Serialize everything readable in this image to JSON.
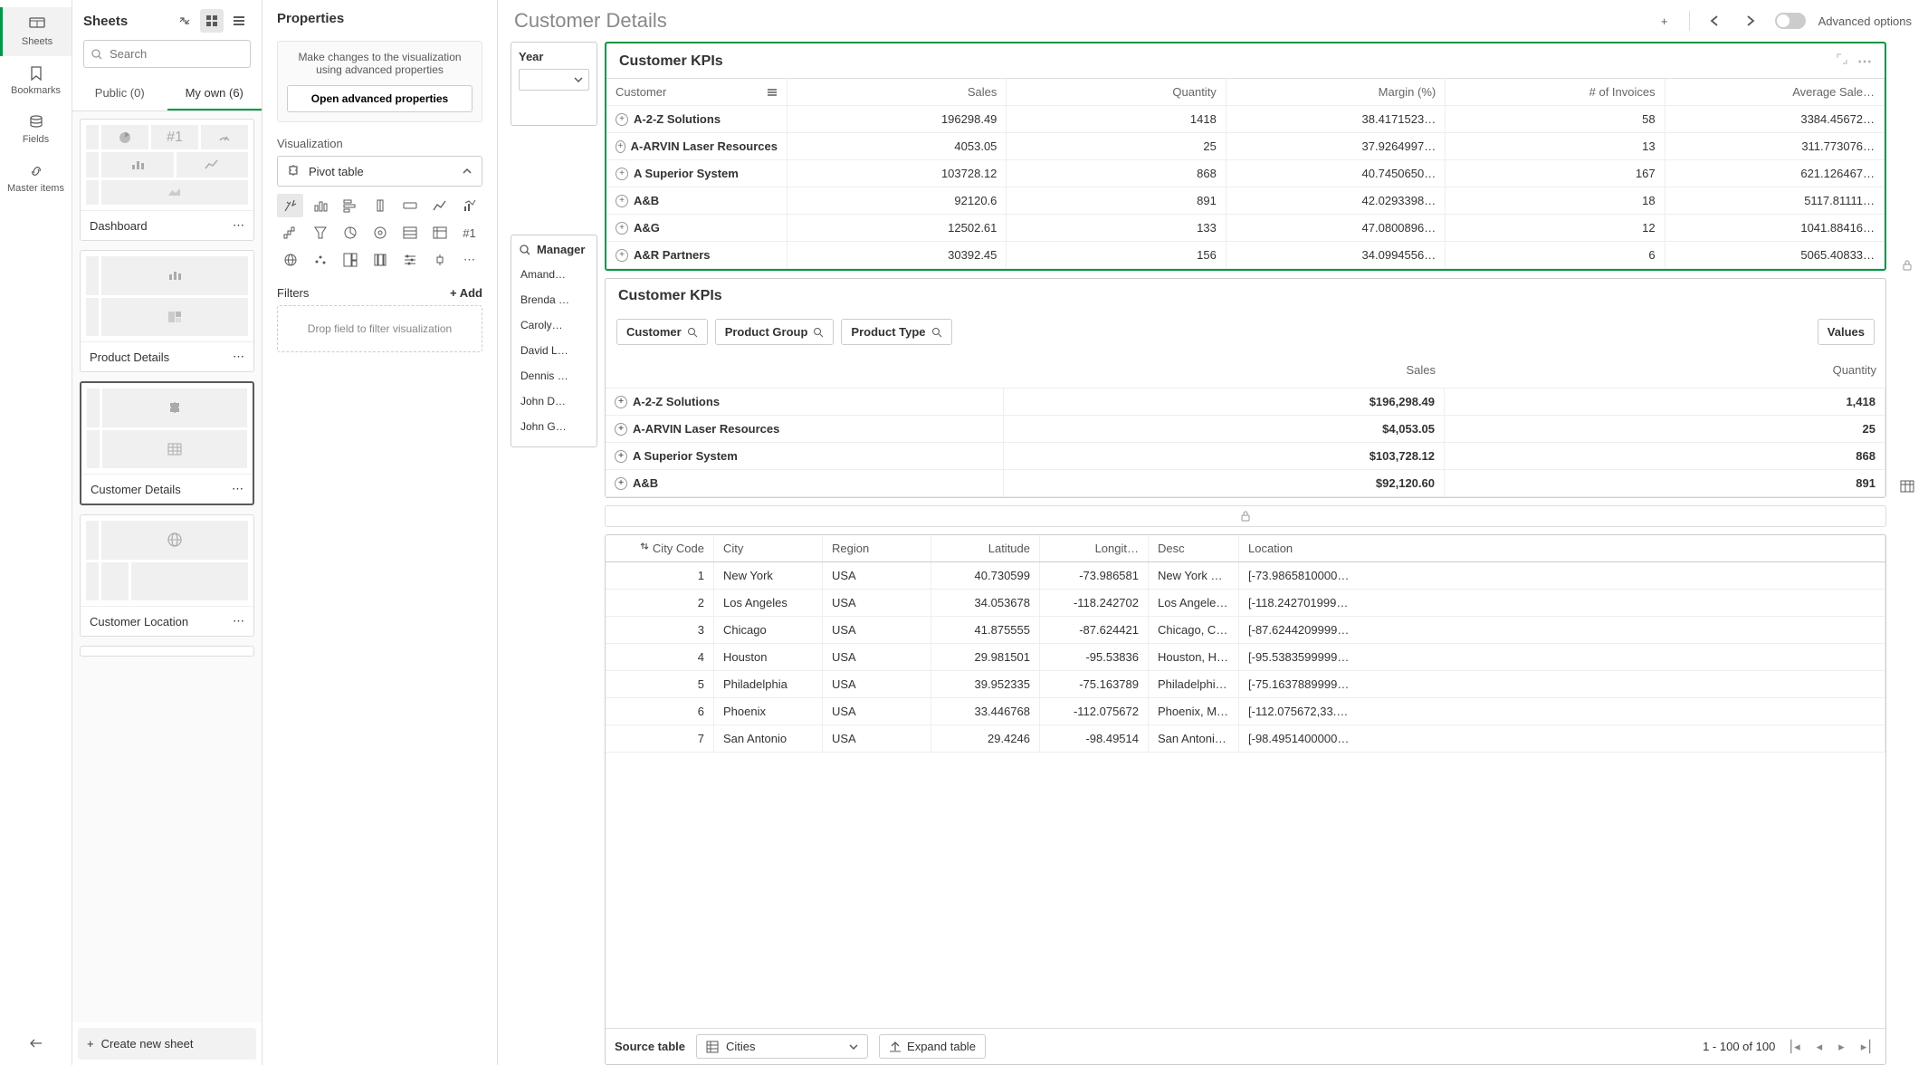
{
  "rail": {
    "sheets": "Sheets",
    "bookmarks": "Bookmarks",
    "fields": "Fields",
    "master": "Master items"
  },
  "sheetsPanel": {
    "title": "Sheets",
    "searchPlaceholder": "Search",
    "tabs": {
      "public": "Public (0)",
      "myown": "My own (6)"
    },
    "cards": [
      {
        "name": "Dashboard"
      },
      {
        "name": "Product Details"
      },
      {
        "name": "Customer Details"
      },
      {
        "name": "Customer Location"
      }
    ],
    "createNew": "Create new sheet"
  },
  "properties": {
    "title": "Properties",
    "hint": "Make changes to the visualization using advanced properties",
    "advBtn": "Open advanced properties",
    "vizSection": "Visualization",
    "vizName": "Pivot table",
    "filtersSection": "Filters",
    "addLabel": "Add",
    "filterDrop": "Drop field to filter visualization"
  },
  "main": {
    "title": "Customer Details",
    "advOptions": "Advanced options",
    "year": {
      "label": "Year"
    },
    "manager": {
      "label": "Manager",
      "items": [
        "Amand…",
        "Brenda …",
        "Caroly…",
        "David L…",
        "Dennis …",
        "John D…",
        "John G…"
      ]
    },
    "kpi1": {
      "title": "Customer KPIs",
      "columns": [
        "Customer",
        "Sales",
        "Quantity",
        "Margin (%)",
        "# of Invoices",
        "Average Sale…"
      ],
      "rows": [
        [
          "A-2-Z Solutions",
          "196298.49",
          "1418",
          "38.4171523…",
          "58",
          "3384.45672…"
        ],
        [
          "A-ARVIN Laser Resources",
          "4053.05",
          "25",
          "37.9264997…",
          "13",
          "311.773076…"
        ],
        [
          "A Superior System",
          "103728.12",
          "868",
          "40.7450650…",
          "167",
          "621.126467…"
        ],
        [
          "A&B",
          "92120.6",
          "891",
          "42.0293398…",
          "18",
          "5117.81111…"
        ],
        [
          "A&G",
          "12502.61",
          "133",
          "47.0800896…",
          "12",
          "1041.88416…"
        ],
        [
          "A&R Partners",
          "30392.45",
          "156",
          "34.0994556…",
          "6",
          "5065.40833…"
        ]
      ]
    },
    "kpi2": {
      "title": "Customer KPIs",
      "chips": [
        "Customer",
        "Product Group",
        "Product Type"
      ],
      "valuesChip": "Values",
      "headers": [
        "Sales",
        "Quantity"
      ],
      "rows": [
        [
          "A-2-Z Solutions",
          "$196,298.49",
          "1,418"
        ],
        [
          "A-ARVIN Laser Resources",
          "$4,053.05",
          "25"
        ],
        [
          "A Superior System",
          "$103,728.12",
          "868"
        ],
        [
          "A&B",
          "$92,120.60",
          "891"
        ]
      ]
    },
    "cityTable": {
      "columns": [
        "City Code",
        "City",
        "Region",
        "Latitude",
        "Longit…",
        "Desc",
        "Location"
      ],
      "rows": [
        [
          "1",
          "New York",
          "USA",
          "40.730599",
          "-73.986581",
          "New York City, N…",
          "[-73.9865810000…"
        ],
        [
          "2",
          "Los Angeles",
          "USA",
          "34.053678",
          "-118.242702",
          "Los Angeles, Los …",
          "[-118.242701999…"
        ],
        [
          "3",
          "Chicago",
          "USA",
          "41.875555",
          "-87.624421",
          "Chicago, Cook C…",
          "[-87.6244209999…"
        ],
        [
          "4",
          "Houston",
          "USA",
          "29.981501",
          "-95.53836",
          "Houston, Harris …",
          "[-95.5383599999…"
        ],
        [
          "5",
          "Philadelphia",
          "USA",
          "39.952335",
          "-75.163789",
          "Philadelphia, Phi…",
          "[-75.1637889999…"
        ],
        [
          "6",
          "Phoenix",
          "USA",
          "33.446768",
          "-112.075672",
          "Phoenix, Marico…",
          "[-112.075672,33.…"
        ],
        [
          "7",
          "San Antonio",
          "USA",
          "29.4246",
          "-98.49514",
          "San Antonio, Bex…",
          "[-98.4951400000…"
        ]
      ]
    },
    "sourceBar": {
      "label": "Source table",
      "source": "Cities",
      "expand": "Expand table",
      "paging": "1 - 100 of 100"
    }
  }
}
